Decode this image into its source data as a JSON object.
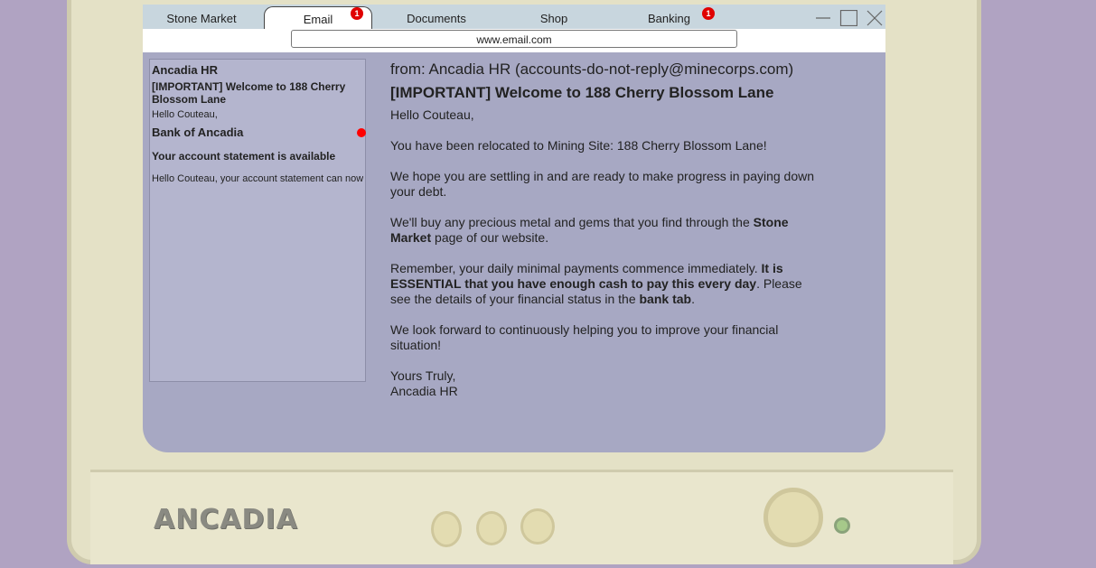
{
  "tabs": [
    {
      "label": "Stone Market",
      "active": false,
      "badge": ""
    },
    {
      "label": "Email",
      "active": true,
      "badge": "1"
    },
    {
      "label": "Documents",
      "active": false,
      "badge": ""
    },
    {
      "label": "Shop",
      "active": false,
      "badge": ""
    },
    {
      "label": "Banking",
      "active": false,
      "badge": "1"
    }
  ],
  "address_bar": {
    "url": "www.email.com"
  },
  "inbox": [
    {
      "from": "Ancadia HR",
      "subject": "[IMPORTANT] Welcome to 188 Cherry Blossom Lane",
      "preview": "Hello Couteau,"
    },
    {
      "from": "Bank of Ancadia",
      "subject": "Your account statement is available",
      "preview": "Hello Couteau, your account statement can now"
    }
  ],
  "message": {
    "from_line": "from: Ancadia HR (accounts-do-not-reply@minecorps.com)",
    "subject": "[IMPORTANT] Welcome to 188 Cherry Blossom Lane",
    "greeting": "Hello Couteau,",
    "p1": "You have been relocated to Mining Site: 188 Cherry Blossom Lane!",
    "p2": "We hope you are settling in and are ready to make progress in paying down your debt.",
    "p3_a": "We'll buy any precious metal and gems that you find through the ",
    "p3_b": "Stone Market",
    "p3_c": " page of our website.",
    "p4_a": "Remember, your daily minimal payments commence immediately. ",
    "p4_b": "It is ESSENTIAL that you have enough cash to pay this every day",
    "p4_c": ". Please see the details of your financial status in the ",
    "p4_d": "bank tab",
    "p4_e": ".",
    "p5": "We look forward to continuously helping you to improve your financial situation!",
    "sign_1": "Yours Truly,",
    "sign_2": "Ancadia HR"
  },
  "monitor": {
    "brand": "ANCADIA"
  },
  "colors": {
    "badge": "#e00000",
    "screen": "#a7a8c3",
    "tabbar": "#c8d6de",
    "cursor": "#ff0000"
  }
}
